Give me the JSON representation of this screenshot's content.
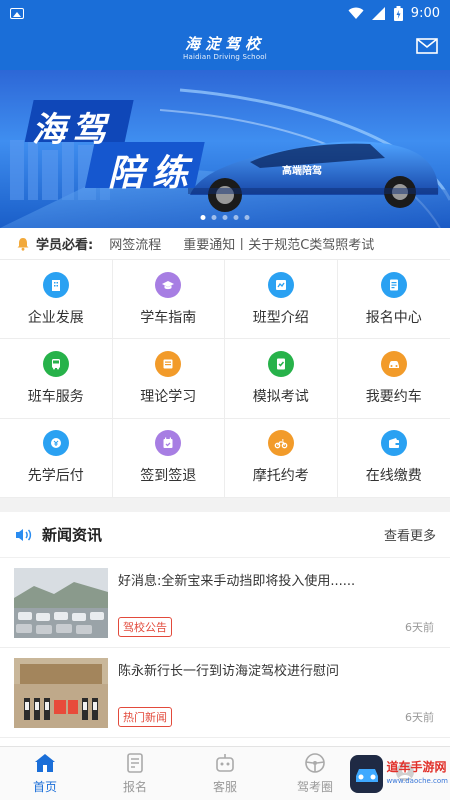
{
  "status_bar": {
    "time": "9:00"
  },
  "header": {
    "title_cn": "海淀驾校",
    "title_en": "Haidian Driving School"
  },
  "banner": {
    "headline_1": "海驾",
    "headline_2": "陪练",
    "car_decal": "高端陪驾",
    "slide_count": 5,
    "active_slide": 1
  },
  "notice": {
    "label": "学员必看:",
    "items": [
      "网签流程",
      "重要通知丨关于规范C类驾照考试"
    ]
  },
  "grid": {
    "items": [
      {
        "label": "企业发展",
        "color": "#2aa1f2",
        "icon": "building-icon"
      },
      {
        "label": "学车指南",
        "color": "#a77ee3",
        "icon": "guide-icon"
      },
      {
        "label": "班型介绍",
        "color": "#2aa1f2",
        "icon": "class-icon"
      },
      {
        "label": "报名中心",
        "color": "#2aa1f2",
        "icon": "signup-icon"
      },
      {
        "label": "班车服务",
        "color": "#27b24a",
        "icon": "bus-icon"
      },
      {
        "label": "理论学习",
        "color": "#f29b2a",
        "icon": "book-icon"
      },
      {
        "label": "模拟考试",
        "color": "#27b24a",
        "icon": "exam-icon"
      },
      {
        "label": "我要约车",
        "color": "#f29b2a",
        "icon": "car-icon"
      },
      {
        "label": "先学后付",
        "color": "#2aa1f2",
        "icon": "pay-later-icon"
      },
      {
        "label": "签到签退",
        "color": "#a77ee3",
        "icon": "checkin-icon"
      },
      {
        "label": "摩托约考",
        "color": "#f29b2a",
        "icon": "motorcycle-icon"
      },
      {
        "label": "在线缴费",
        "color": "#2aa1f2",
        "icon": "wallet-icon"
      }
    ]
  },
  "news": {
    "title": "新闻资讯",
    "more": "查看更多",
    "items": [
      {
        "title": "好消息:全新宝来手动挡即将投入使用......",
        "tag": "驾校公告",
        "time": "6天前"
      },
      {
        "title": "陈永新行长一行到访海淀驾校进行慰问",
        "tag": "热门新闻",
        "time": "6天前"
      }
    ]
  },
  "bottom_nav": {
    "items": [
      {
        "label": "首页",
        "active": true
      },
      {
        "label": "报名",
        "active": false
      },
      {
        "label": "客服",
        "active": false
      },
      {
        "label": "驾考圈",
        "active": false
      },
      {
        "label": "",
        "active": false
      }
    ]
  },
  "watermark": {
    "line1": "道车手游网",
    "line2": "www.daoche.com"
  },
  "colors": {
    "primary": "#1a6ed8",
    "tag_red": "#e24a3b"
  }
}
